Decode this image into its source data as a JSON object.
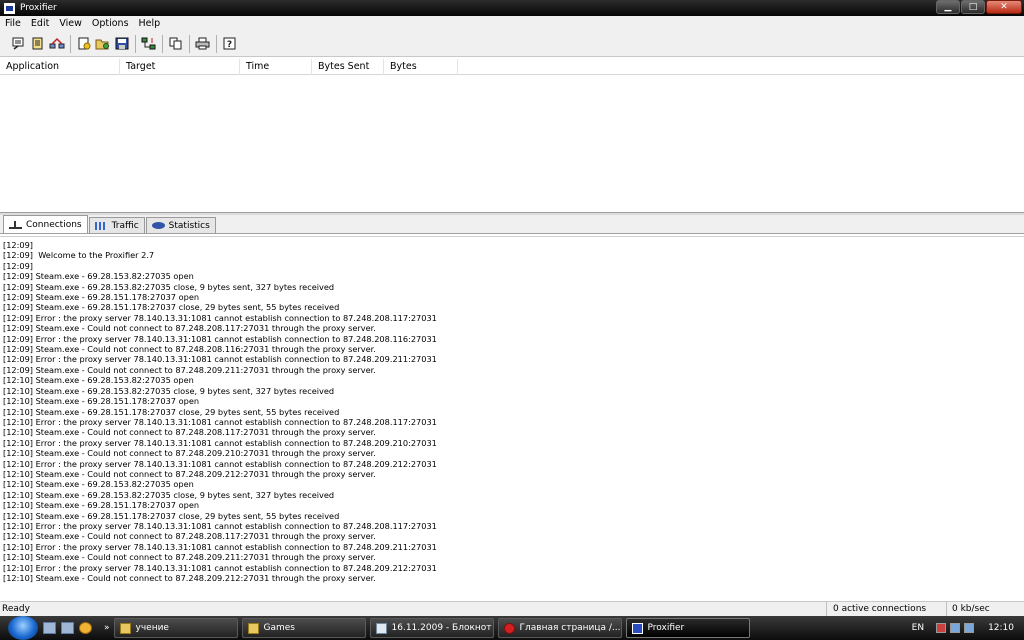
{
  "window": {
    "title": "Proxifier",
    "controls": {
      "minimize": "▁",
      "maximize": "□",
      "close": "✕"
    }
  },
  "menu": [
    "File",
    "Edit",
    "View",
    "Options",
    "Help"
  ],
  "toolbar": {
    "icons": [
      "profile-icon",
      "rules-icon",
      "proxy-servers-icon",
      "new-profile-icon",
      "open-profile-icon",
      "save-profile-icon",
      "connections-icon",
      "copy-icon",
      "print-icon",
      "help-icon"
    ]
  },
  "connections": {
    "columns": [
      "Application",
      "Target",
      "Time",
      "Bytes Sent",
      "Bytes Received"
    ]
  },
  "tabs": [
    {
      "label": "Connections",
      "icon": "connections-tab-icon"
    },
    {
      "label": "Traffic",
      "icon": "traffic-tab-icon"
    },
    {
      "label": "Statistics",
      "icon": "statistics-tab-icon"
    }
  ],
  "log": [
    "[12:09]",
    "[12:09]  Welcome to the Proxifier 2.7",
    "[12:09]",
    "[12:09] Steam.exe - 69.28.153.82:27035 open",
    "[12:09] Steam.exe - 69.28.153.82:27035 close, 9 bytes sent, 327 bytes received",
    "[12:09] Steam.exe - 69.28.151.178:27037 open",
    "[12:09] Steam.exe - 69.28.151.178:27037 close, 29 bytes sent, 55 bytes received",
    "[12:09] Error : the proxy server 78.140.13.31:1081 cannot establish connection to 87.248.208.117:27031",
    "[12:09] Steam.exe - Could not connect to 87.248.208.117:27031 through the proxy server.",
    "[12:09] Error : the proxy server 78.140.13.31:1081 cannot establish connection to 87.248.208.116:27031",
    "[12:09] Steam.exe - Could not connect to 87.248.208.116:27031 through the proxy server.",
    "[12:09] Error : the proxy server 78.140.13.31:1081 cannot establish connection to 87.248.209.211:27031",
    "[12:09] Steam.exe - Could not connect to 87.248.209.211:27031 through the proxy server.",
    "[12:10] Steam.exe - 69.28.153.82:27035 open",
    "[12:10] Steam.exe - 69.28.153.82:27035 close, 9 bytes sent, 327 bytes received",
    "[12:10] Steam.exe - 69.28.151.178:27037 open",
    "[12:10] Steam.exe - 69.28.151.178:27037 close, 29 bytes sent, 55 bytes received",
    "[12:10] Error : the proxy server 78.140.13.31:1081 cannot establish connection to 87.248.208.117:27031",
    "[12:10] Steam.exe - Could not connect to 87.248.208.117:27031 through the proxy server.",
    "[12:10] Error : the proxy server 78.140.13.31:1081 cannot establish connection to 87.248.209.210:27031",
    "[12:10] Steam.exe - Could not connect to 87.248.209.210:27031 through the proxy server.",
    "[12:10] Error : the proxy server 78.140.13.31:1081 cannot establish connection to 87.248.209.212:27031",
    "[12:10] Steam.exe - Could not connect to 87.248.209.212:27031 through the proxy server.",
    "[12:10] Steam.exe - 69.28.153.82:27035 open",
    "[12:10] Steam.exe - 69.28.153.82:27035 close, 9 bytes sent, 327 bytes received",
    "[12:10] Steam.exe - 69.28.151.178:27037 open",
    "[12:10] Steam.exe - 69.28.151.178:27037 close, 29 bytes sent, 55 bytes received",
    "[12:10] Error : the proxy server 78.140.13.31:1081 cannot establish connection to 87.248.208.117:27031",
    "[12:10] Steam.exe - Could not connect to 87.248.208.117:27031 through the proxy server.",
    "[12:10] Error : the proxy server 78.140.13.31:1081 cannot establish connection to 87.248.209.211:27031",
    "[12:10] Steam.exe - Could not connect to 87.248.209.211:27031 through the proxy server.",
    "[12:10] Error : the proxy server 78.140.13.31:1081 cannot establish connection to 87.248.209.212:27031",
    "[12:10] Steam.exe - Could not connect to 87.248.209.212:27031 through the proxy server."
  ],
  "status": {
    "ready": "Ready",
    "connections": "0 active connections",
    "rate": "0 kb/sec"
  },
  "taskbar": {
    "more": "»",
    "buttons": [
      {
        "label": "учение",
        "icon": "folder-icon"
      },
      {
        "label": "Games",
        "icon": "folder-icon"
      },
      {
        "label": "16.11.2009 - Блокнот",
        "icon": "notepad-icon"
      },
      {
        "label": "Главная страница /...",
        "icon": "opera-icon"
      },
      {
        "label": "Proxifier",
        "icon": "proxifier-icon"
      }
    ],
    "lang": "EN",
    "clock": "12:10"
  }
}
